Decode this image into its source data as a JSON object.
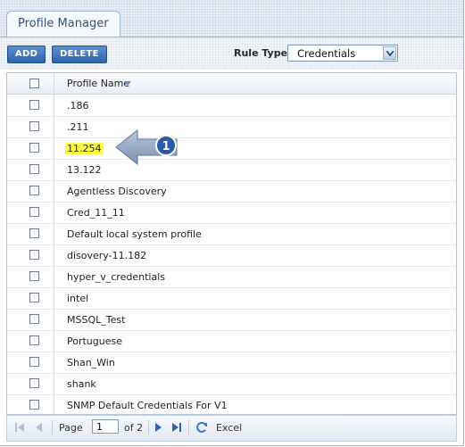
{
  "header": {
    "tab_label": "Profile Manager"
  },
  "toolbar": {
    "add_label": "ADD",
    "delete_label": "DELETE",
    "rule_type_label": "Rule Type",
    "rule_type_value": "Credentials"
  },
  "grid": {
    "column_header": "Profile Name",
    "rows": [
      ".186",
      ".211",
      "11.254",
      "13.122",
      "Agentless Discovery",
      "Cred_11_11",
      "Default local system profile",
      "disovery-11.182",
      "hyper_v_credentials",
      "intel",
      "MSSQL_Test",
      "Portuguese",
      "Shan_Win",
      "shank",
      "SNMP Default Credentials For V1"
    ],
    "highlighted_row": "11.254"
  },
  "callout": {
    "number": "1"
  },
  "pager": {
    "page_label": "Page",
    "page_value": "1",
    "of_label": "of 2",
    "excel_label": "Excel"
  },
  "colors": {
    "button_blue": "#2f63ad",
    "highlight_yellow": "#ffff44",
    "arrow_fill": "#8fa3bf",
    "badge_blue": "#2a5aa8"
  },
  "icons": [
    "sort-desc-icon",
    "chevron-down-icon",
    "first-page-icon",
    "prev-page-icon",
    "next-page-icon",
    "last-page-icon",
    "refresh-icon"
  ]
}
